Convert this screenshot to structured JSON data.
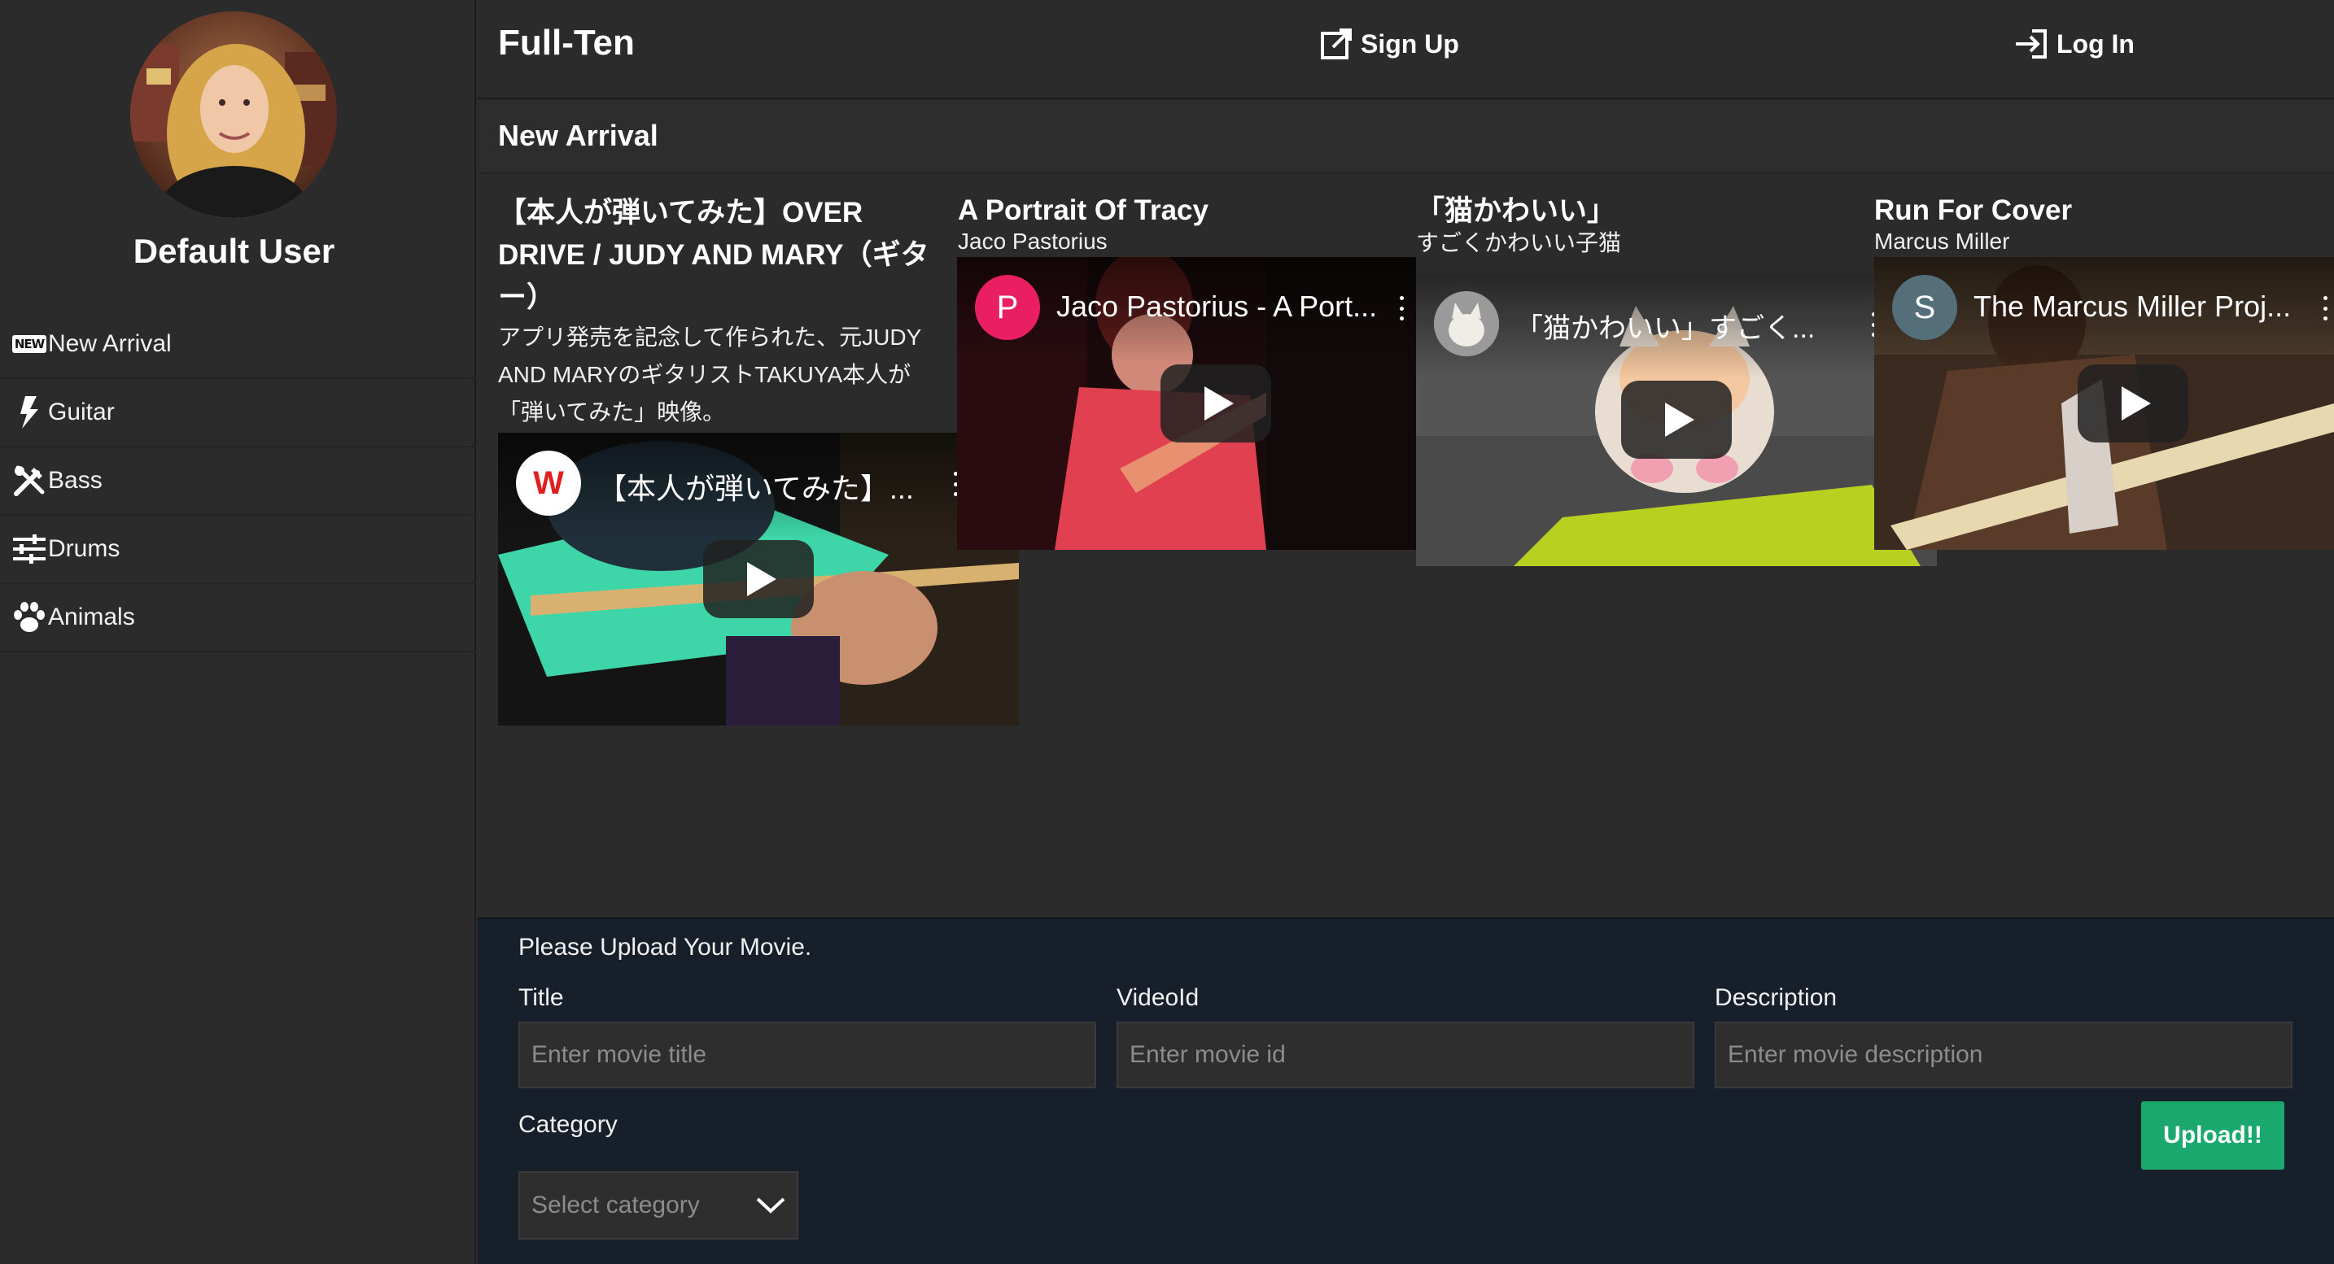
{
  "sidebar": {
    "user_name": "Default User",
    "items": [
      {
        "label": "New Arrival",
        "icon": "new-badge-icon",
        "badge": "NEW"
      },
      {
        "label": "Guitar",
        "icon": "lightning-icon"
      },
      {
        "label": "Bass",
        "icon": "tools-icon"
      },
      {
        "label": "Drums",
        "icon": "sliders-icon"
      },
      {
        "label": "Animals",
        "icon": "paw-icon"
      }
    ]
  },
  "header": {
    "brand": "Full-Ten",
    "signup_label": "Sign Up",
    "login_label": "Log In"
  },
  "section": {
    "title": "New Arrival"
  },
  "movies": [
    {
      "title": "【本人が弾いてみた】OVER DRIVE / JUDY AND MARY（ギター）",
      "description": "アプリ発売を記念して作られた、元JUDY AND MARYのギタリストTAKUYA本人が「弾いてみた」映像。",
      "video_title": "【本人が弾いてみた】...",
      "channel_initial": "W"
    },
    {
      "title": "A Portrait Of Tracy",
      "description": "Jaco Pastorius",
      "video_title": "Jaco Pastorius - A Port...",
      "channel_initial": "P"
    },
    {
      "title": "「猫かわいい」",
      "description": "すごくかわいい子猫",
      "video_title": "「猫かわいい」すごく...",
      "channel_initial": ""
    },
    {
      "title": "Run For Cover",
      "description": "Marcus Miller",
      "video_title": "The Marcus Miller Proj...",
      "channel_initial": "S"
    }
  ],
  "upload": {
    "heading": "Please Upload Your Movie.",
    "title_label": "Title",
    "title_placeholder": "Enter movie title",
    "videoid_label": "VideoId",
    "videoid_placeholder": "Enter movie id",
    "description_label": "Description",
    "description_placeholder": "Enter movie description",
    "category_label": "Category",
    "category_placeholder": "Select category",
    "submit_label": "Upload!!"
  },
  "colors": {
    "background": "#2b2b2b",
    "upload_panel": "#17202a",
    "upload_button": "#1aa86e",
    "channel_p": "#e91e63",
    "channel_s": "#546e7a"
  }
}
